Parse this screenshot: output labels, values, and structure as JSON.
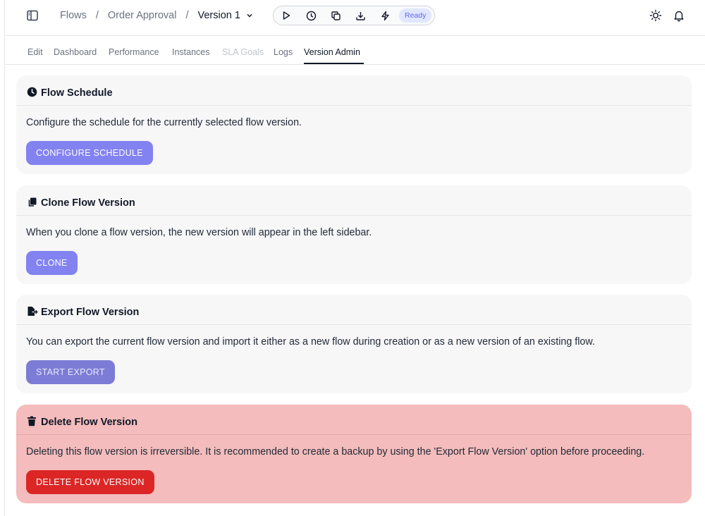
{
  "breadcrumb": {
    "items": [
      "Flows",
      "Order Approval"
    ],
    "separator": "/",
    "current": "Version 1"
  },
  "toolbar": {
    "icons": [
      "play-icon",
      "clock-icon",
      "copy-icon",
      "download-icon",
      "lightning-icon"
    ],
    "status": "Ready"
  },
  "header_icons": [
    "sidebar-toggle-icon",
    "sun-icon",
    "bell-icon"
  ],
  "tabs": [
    {
      "label": "Edit",
      "state": "normal"
    },
    {
      "label": "Dashboard",
      "state": "normal"
    },
    {
      "label": "Performance",
      "state": "normal"
    },
    {
      "label": "Instances",
      "state": "normal"
    },
    {
      "label": "SLA Goals",
      "state": "disabled"
    },
    {
      "label": "Logs",
      "state": "normal"
    },
    {
      "label": "Version Admin",
      "state": "active"
    }
  ],
  "cards": [
    {
      "icon": "clock-icon",
      "title": "Flow Schedule",
      "description": "Configure the schedule for the currently selected flow version.",
      "button": "CONFIGURE SCHEDULE"
    },
    {
      "icon": "copy-icon",
      "title": "Clone Flow Version",
      "description": "When you clone a flow version, the new version will appear in the left sidebar.",
      "button": "CLONE"
    },
    {
      "icon": "file-export-icon",
      "title": "Export Flow Version",
      "description": "You can export the current flow version and import it either as a new flow during creation or as a new version of an existing flow.",
      "button": "START EXPORT"
    },
    {
      "icon": "trash-icon",
      "title": "Delete Flow Version",
      "description": "Deleting this flow version is irreversible. It is recommended to create a backup by using the 'Export Flow Version' option before proceeding.",
      "button": "DELETE FLOW VERSION"
    }
  ],
  "colors": {
    "primary_button": "#8282f0",
    "danger_button": "#dc2626",
    "danger_card": "#f4bcbc",
    "card_background": "#f7f7f8",
    "status_badge_text": "#6366f1",
    "status_badge_background": "#e0e7ff"
  }
}
